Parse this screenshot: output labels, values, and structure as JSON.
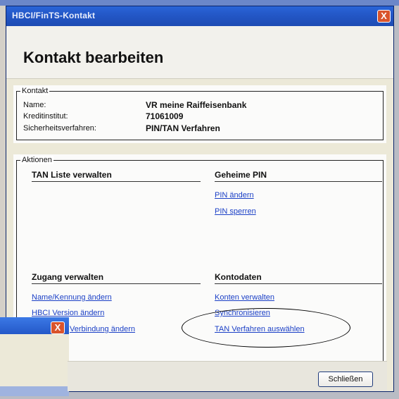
{
  "window": {
    "title": "HBCI/FinTS-Kontakt",
    "close_symbol": "X"
  },
  "header": {
    "title": "Kontakt bearbeiten"
  },
  "kontakt": {
    "legend": "Kontakt",
    "rows": [
      {
        "label": "Name:",
        "value": "VR meine Raiffeisenbank"
      },
      {
        "label": "Kreditinstitut:",
        "value": "71061009"
      },
      {
        "label": "Sicherheitsverfahren:",
        "value": "PIN/TAN Verfahren"
      }
    ]
  },
  "aktionen": {
    "legend": "Aktionen",
    "tan_liste": {
      "title": "TAN Liste verwalten"
    },
    "geheime_pin": {
      "title": "Geheime PIN",
      "links": [
        "PIN ändern",
        "PIN sperren"
      ]
    },
    "zugang": {
      "title": "Zugang verwalten",
      "links": [
        "Name/Kennung ändern",
        "HBCI Version ändern",
        "Verbindung ändern"
      ]
    },
    "kontodaten": {
      "title": "Kontodaten",
      "links": [
        "Konten verwalten",
        "Synchronisieren",
        "TAN Verfahren auswählen"
      ]
    }
  },
  "footer": {
    "close_button": "Schließen"
  },
  "overlay_window": {
    "close_symbol": "X"
  },
  "colors": {
    "titlebar": "#2458c8",
    "link": "#1a3fc6",
    "close": "#d9542c",
    "background": "#ece9d8"
  }
}
